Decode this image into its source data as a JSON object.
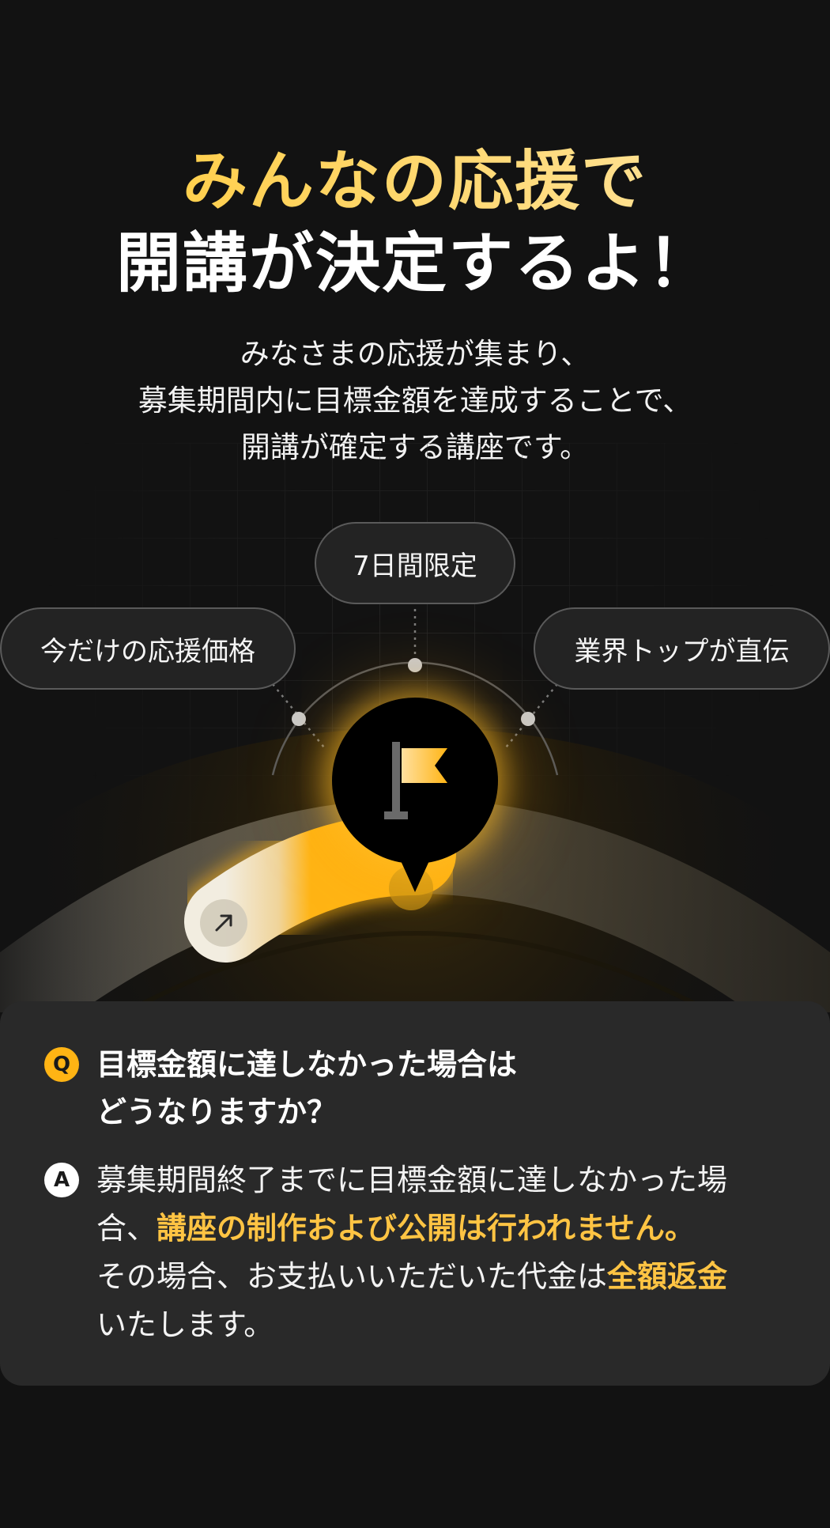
{
  "headline": {
    "line1": "みんなの応援で",
    "line2": "開講が決定するよ！"
  },
  "lead": {
    "line1": "みなさまの応援が集まり、",
    "line2": "募集期間内に目標金額を達成することで、",
    "line3": "開講が確定する講座です。"
  },
  "visual": {
    "pill_top": "7日間限定",
    "pill_left": "今だけの応援価格",
    "pill_right": "業界トップが直伝",
    "center_icon": "flag-icon",
    "progress_icon": "arrow-up-right-icon",
    "accent_color": "#ffb414"
  },
  "faq": {
    "q_icon_label": "Q",
    "question_line1": "目標金額に達しなかった場合は",
    "question_line2": "どうなりますか？",
    "a_icon_label": "A",
    "answer_part1": "募集期間終了までに目標金額に達しなかった場合、",
    "answer_highlight1": "講座の制作および公開は行われません。",
    "answer_part2": "その場合、お支払いいただいた代金は",
    "answer_highlight2": "全額返金",
    "answer_part3": "いたします。"
  }
}
